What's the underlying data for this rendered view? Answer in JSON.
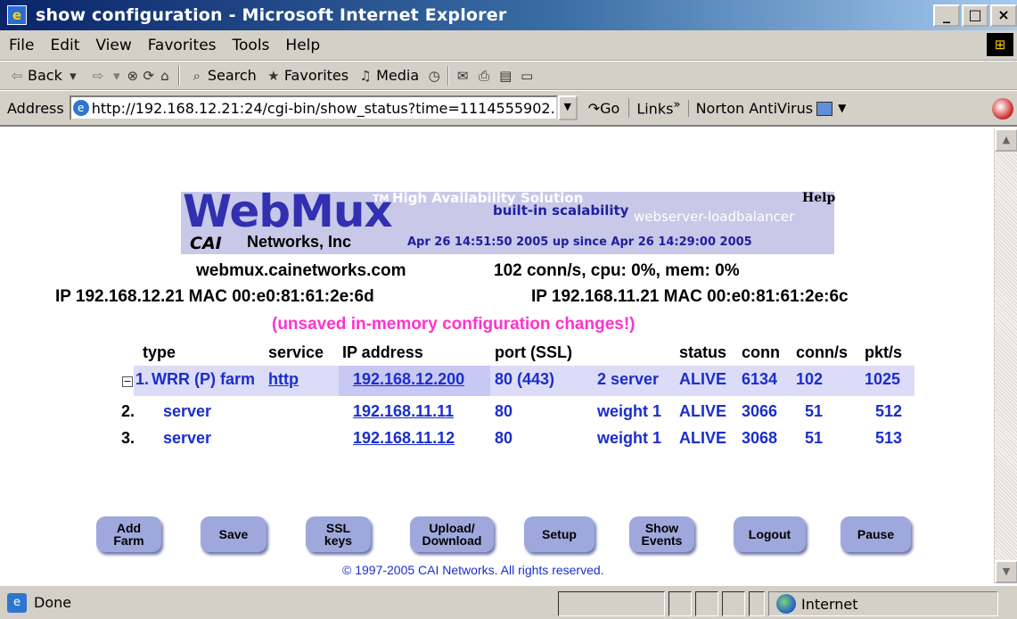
{
  "window": {
    "title": "show configuration - Microsoft Internet Explorer",
    "minimize": "_",
    "maximize": "□",
    "close": "×"
  },
  "menu": {
    "items": [
      "File",
      "Edit",
      "View",
      "Favorites",
      "Tools",
      "Help"
    ]
  },
  "toolbar": {
    "back": "Back",
    "search": "Search",
    "favorites": "Favorites",
    "media": "Media"
  },
  "address": {
    "label": "Address",
    "url": "http://192.168.12.21:24/cgi-bin/show_status?time=1114555902.",
    "go": "Go",
    "links": "Links",
    "links_chevron": "»",
    "norton": "Norton AntiVirus"
  },
  "banner": {
    "logo": "WebMux",
    "tm": "TM",
    "tagline1": "High Availability Solution",
    "tagline2": "built-in scalability",
    "tagline3": "webserver-loadbalancer",
    "help": "Help",
    "company_logo": "CAI",
    "company": "Networks, Inc",
    "uptime": "Apr 26 14:51:50 2005 up since Apr 26 14:29:00 2005"
  },
  "host": {
    "name": "webmux.cainetworks.com",
    "stats": "102 conn/s, cpu: 0%, mem: 0%",
    "ip1": "IP 192.168.12.21  MAC 00:e0:81:61:2e:6d",
    "ip2": "IP 192.168.11.21  MAC 00:e0:81:61:2e:6c",
    "warning": "(unsaved in-memory configuration changes!)"
  },
  "table": {
    "headers": {
      "type": "type",
      "service": "service",
      "ip": "IP address",
      "port": "port (SSL)",
      "status": "status",
      "conn": "conn",
      "conns": "conn/s",
      "pkts": "pkt/s"
    },
    "farm": {
      "collapse": "−",
      "num": "1.",
      "type": "WRR (P) farm",
      "service": "http",
      "ip": "192.168.12.200",
      "port": "80 (443)",
      "servers": "2 server",
      "status": "ALIVE",
      "conn": "6134",
      "conns": "102",
      "pkts": "1025"
    },
    "rows": [
      {
        "num": "2.",
        "type": "server",
        "ip": "192.168.11.11",
        "port": "80",
        "weight": "weight 1",
        "status": "ALIVE",
        "conn": "3066",
        "conns": "51",
        "pkts": "512"
      },
      {
        "num": "3.",
        "type": "server",
        "ip": "192.168.11.12",
        "port": "80",
        "weight": "weight 1",
        "status": "ALIVE",
        "conn": "3068",
        "conns": "51",
        "pkts": "513"
      }
    ]
  },
  "buttons": {
    "add_farm": "Add\nFarm",
    "save": "Save",
    "ssl_keys": "SSL\nkeys",
    "upload": "Upload/\nDownload",
    "setup": "Setup",
    "show_events": "Show\nEvents",
    "logout": "Logout",
    "pause": "Pause"
  },
  "footer": {
    "copyright": "© 1997-2005 CAI Networks. All rights reserved."
  },
  "status": {
    "text": "Done",
    "zone": "Internet"
  }
}
